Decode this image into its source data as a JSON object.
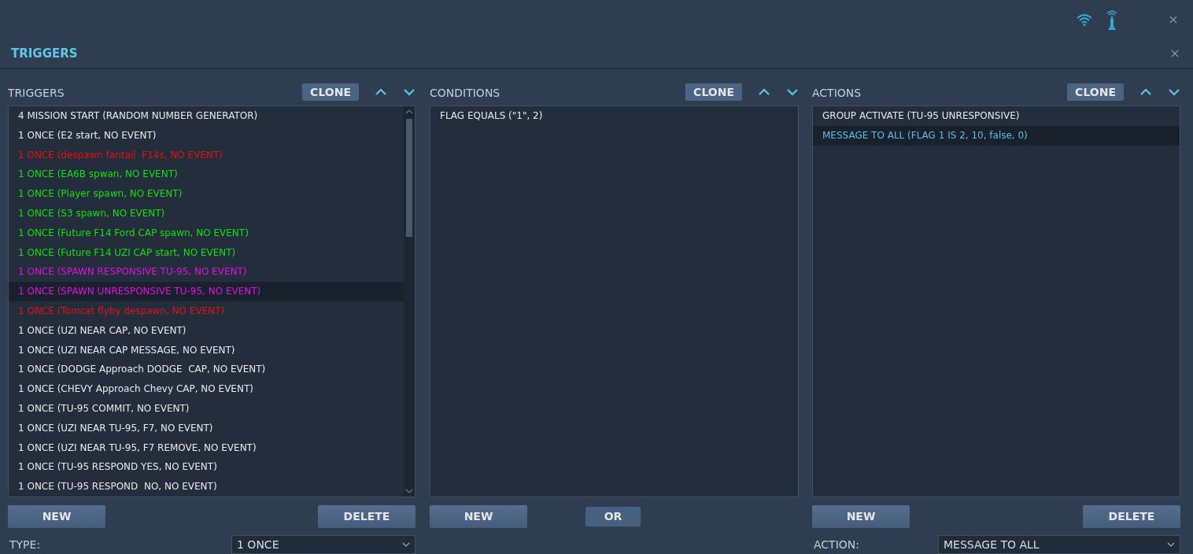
{
  "window": {
    "title": "TRIGGERS"
  },
  "panels": [
    {
      "title": "TRIGGERS",
      "clone": "CLONE",
      "scrollbar": true,
      "items": [
        {
          "text": "4 MISSION START (RANDOM NUMBER GENERATOR)",
          "color": "#e8e8e8",
          "selected": false
        },
        {
          "text": "1 ONCE (E2 start, NO EVENT)",
          "color": "#e8e8e8",
          "selected": false
        },
        {
          "text": "1 ONCE (despawn fantail  F14s, NO EVENT)",
          "color": "#e51010",
          "selected": false
        },
        {
          "text": "1 ONCE (EA6B spwan, NO EVENT)",
          "color": "#10e010",
          "selected": false
        },
        {
          "text": "1 ONCE (Player spawn, NO EVENT)",
          "color": "#10e010",
          "selected": false
        },
        {
          "text": "1 ONCE (S3 spawn, NO EVENT)",
          "color": "#10e010",
          "selected": false
        },
        {
          "text": "1 ONCE (Future F14 Ford CAP spawn, NO EVENT)",
          "color": "#10e010",
          "selected": false
        },
        {
          "text": "1 ONCE (Future F14 UZI CAP start, NO EVENT)",
          "color": "#10e010",
          "selected": false
        },
        {
          "text": "1 ONCE (SPAWN RESPONSIVE TU-95, NO EVENT)",
          "color": "#e010e0",
          "selected": false
        },
        {
          "text": "1 ONCE (SPAWN UNRESPONSIVE TU-95, NO EVENT)",
          "color": "#e010e0",
          "selected": true
        },
        {
          "text": "1 ONCE (Tomcat flyby despawn, NO EVENT)",
          "color": "#e51010",
          "selected": false
        },
        {
          "text": "1 ONCE (UZI NEAR CAP, NO EVENT)",
          "color": "#e8e8e8",
          "selected": false
        },
        {
          "text": "1 ONCE (UZI NEAR CAP MESSAGE, NO EVENT)",
          "color": "#e8e8e8",
          "selected": false
        },
        {
          "text": "1 ONCE (DODGE Approach DODGE  CAP, NO EVENT)",
          "color": "#e8e8e8",
          "selected": false
        },
        {
          "text": "1 ONCE (CHEVY Approach Chevy CAP, NO EVENT)",
          "color": "#e8e8e8",
          "selected": false
        },
        {
          "text": "1 ONCE (TU-95 COMMIT, NO EVENT)",
          "color": "#e8e8e8",
          "selected": false
        },
        {
          "text": "1 ONCE (UZI NEAR TU-95, F7, NO EVENT)",
          "color": "#e8e8e8",
          "selected": false
        },
        {
          "text": "1 ONCE (UZI NEAR TU-95, F7 REMOVE, NO EVENT)",
          "color": "#e8e8e8",
          "selected": false
        },
        {
          "text": "1 ONCE (TU-95 RESPOND YES, NO EVENT)",
          "color": "#e8e8e8",
          "selected": false
        },
        {
          "text": "1 ONCE (TU-95 RESPOND  NO, NO EVENT)",
          "color": "#e8e8e8",
          "selected": false
        }
      ],
      "buttons": [
        {
          "label": "NEW",
          "kind": "main"
        },
        {
          "label": "DELETE",
          "kind": "main"
        }
      ],
      "field": {
        "label": "TYPE:",
        "value": "1 ONCE"
      }
    },
    {
      "title": "CONDITIONS",
      "clone": "CLONE",
      "scrollbar": false,
      "items": [
        {
          "text": "FLAG EQUALS (\"1\", 2)",
          "color": "#e8e8e8",
          "selected": false
        }
      ],
      "buttons": [
        {
          "label": "NEW",
          "kind": "main"
        },
        {
          "label": "OR",
          "kind": "small"
        }
      ]
    },
    {
      "title": "ACTIONS",
      "clone": "CLONE",
      "scrollbar": false,
      "items": [
        {
          "text": "GROUP ACTIVATE (TU-95 UNRESPONSIVE)",
          "color": "#e8e8e8",
          "selected": false
        },
        {
          "text": "MESSAGE TO ALL (FLAG 1 IS 2, 10, false, 0)",
          "color": "#5bbfe0",
          "selected": true
        }
      ],
      "buttons": [
        {
          "label": "NEW",
          "kind": "main"
        },
        {
          "label": "DELETE",
          "kind": "main"
        }
      ],
      "field": {
        "label": "ACTION:",
        "value": "MESSAGE TO ALL"
      }
    }
  ]
}
